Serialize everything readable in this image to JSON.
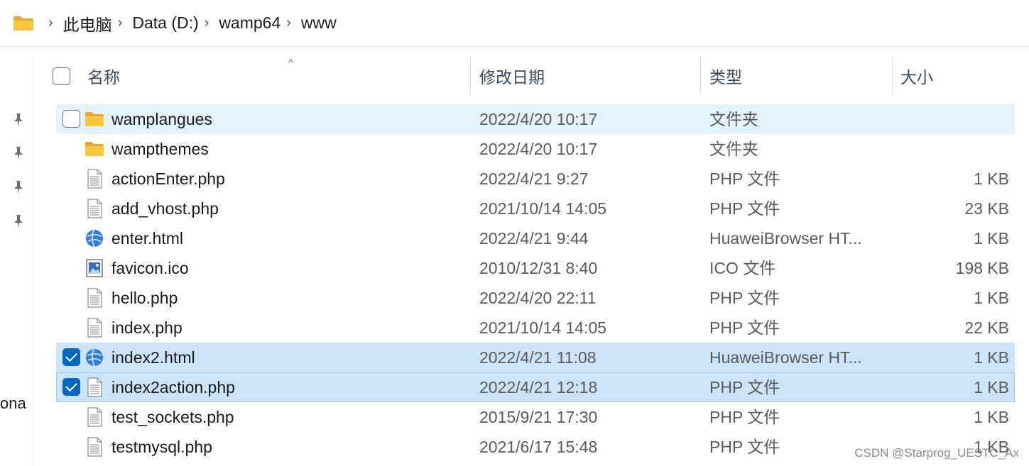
{
  "breadcrumb": {
    "items": [
      "此电脑",
      "Data (D:)",
      "wamp64",
      "www"
    ],
    "separator": "›"
  },
  "navstrip": {
    "fragment_text": "ona"
  },
  "columns": {
    "name": "名称",
    "date": "修改日期",
    "type": "类型",
    "size": "大小",
    "sort_indicator": "^"
  },
  "files": [
    {
      "name": "wamplangues",
      "date": "2022/4/20 10:17",
      "type": "文件夹",
      "size": "",
      "icon": "folder-icon",
      "state": "hover",
      "checked": false,
      "show_checkbox": true
    },
    {
      "name": "wampthemes",
      "date": "2022/4/20 10:17",
      "type": "文件夹",
      "size": "",
      "icon": "folder-icon",
      "state": "",
      "checked": false,
      "show_checkbox": false
    },
    {
      "name": "actionEnter.php",
      "date": "2022/4/21 9:27",
      "type": "PHP 文件",
      "size": "1 KB",
      "icon": "document-icon",
      "state": "",
      "checked": false,
      "show_checkbox": false
    },
    {
      "name": "add_vhost.php",
      "date": "2021/10/14 14:05",
      "type": "PHP 文件",
      "size": "23 KB",
      "icon": "document-icon",
      "state": "",
      "checked": false,
      "show_checkbox": false
    },
    {
      "name": "enter.html",
      "date": "2022/4/21 9:44",
      "type": "HuaweiBrowser HT...",
      "size": "1 KB",
      "icon": "browser-icon",
      "state": "",
      "checked": false,
      "show_checkbox": false
    },
    {
      "name": "favicon.ico",
      "date": "2010/12/31 8:40",
      "type": "ICO 文件",
      "size": "198 KB",
      "icon": "image-icon",
      "state": "",
      "checked": false,
      "show_checkbox": false
    },
    {
      "name": "hello.php",
      "date": "2022/4/20 22:11",
      "type": "PHP 文件",
      "size": "1 KB",
      "icon": "document-icon",
      "state": "",
      "checked": false,
      "show_checkbox": false
    },
    {
      "name": "index.php",
      "date": "2021/10/14 14:05",
      "type": "PHP 文件",
      "size": "22 KB",
      "icon": "document-icon",
      "state": "",
      "checked": false,
      "show_checkbox": false
    },
    {
      "name": "index2.html",
      "date": "2022/4/21 11:08",
      "type": "HuaweiBrowser HT...",
      "size": "1 KB",
      "icon": "browser-icon",
      "state": "selected",
      "checked": true,
      "show_checkbox": true
    },
    {
      "name": "index2action.php",
      "date": "2022/4/21 12:18",
      "type": "PHP 文件",
      "size": "1 KB",
      "icon": "document-icon",
      "state": "selected focused",
      "checked": true,
      "show_checkbox": true
    },
    {
      "name": "test_sockets.php",
      "date": "2015/9/21 17:30",
      "type": "PHP 文件",
      "size": "1 KB",
      "icon": "document-icon",
      "state": "",
      "checked": false,
      "show_checkbox": false
    },
    {
      "name": "testmysql.php",
      "date": "2021/6/17 15:48",
      "type": "PHP 文件",
      "size": "1 KB",
      "icon": "document-icon",
      "state": "",
      "checked": false,
      "show_checkbox": false
    }
  ],
  "watermark": "CSDN @Starprog_UESTC_Ax",
  "colors": {
    "accent": "#0067c0",
    "selected_row": "#cce4f7",
    "hover_row": "#e5f1fb",
    "folder": "#f8c640"
  }
}
